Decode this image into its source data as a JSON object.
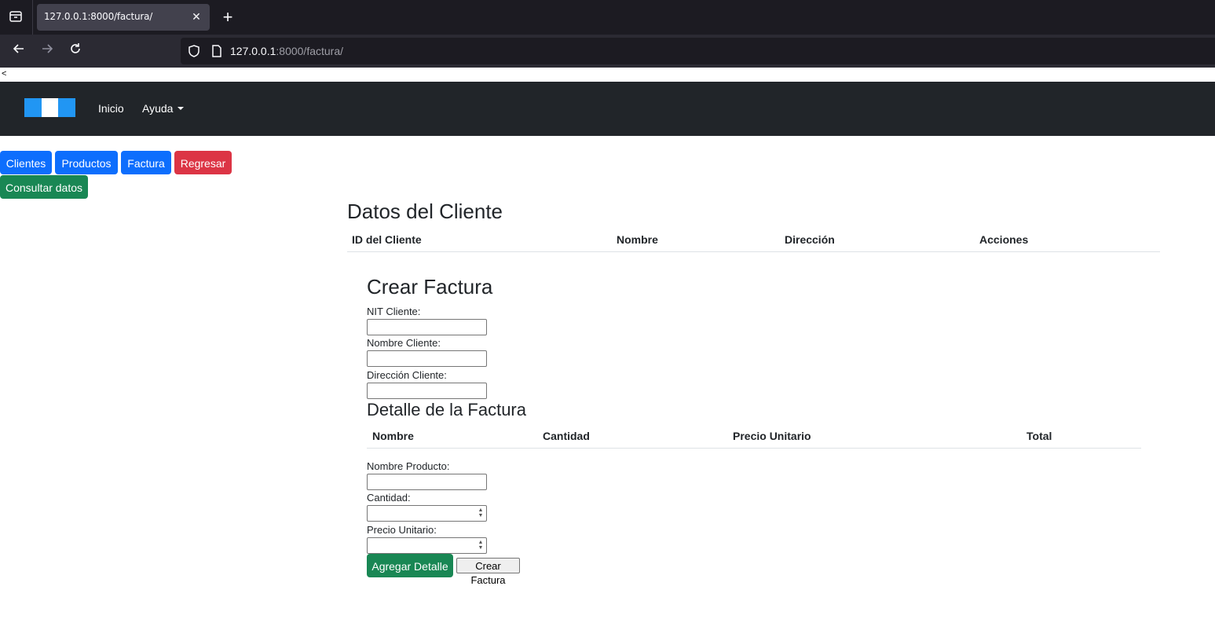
{
  "browser": {
    "tab_title": "127.0.0.1:8000/factura/",
    "url_host": "127.0.0.1",
    "url_path": ":8000/factura/"
  },
  "page": {
    "stray_text": "<",
    "navbar": {
      "brand_colors": [
        "#2196f3",
        "#ffffff",
        "#2196f3"
      ],
      "links": [
        "Inicio",
        "Ayuda"
      ]
    },
    "buttons": {
      "clientes": "Clientes",
      "productos": "Productos",
      "factura": "Factura",
      "regresar": "Regresar",
      "consultar": "Consultar datos"
    },
    "clientes_section": {
      "title": "Datos del Cliente",
      "headers": [
        "ID del Cliente",
        "Nombre",
        "Dirección",
        "Acciones"
      ]
    },
    "factura_form": {
      "title": "Crear Factura",
      "nit_label": "NIT Cliente:",
      "nombre_label": "Nombre Cliente:",
      "direccion_label": "Dirección Cliente:",
      "nit_value": "",
      "nombre_value": "",
      "direccion_value": ""
    },
    "detalle": {
      "title": "Detalle de la Factura",
      "headers": [
        "Nombre",
        "Cantidad",
        "Precio Unitario",
        "Total"
      ],
      "producto_label": "Nombre Producto:",
      "cantidad_label": "Cantidad:",
      "precio_label": "Precio Unitario:",
      "producto_value": "",
      "cantidad_value": "",
      "precio_value": "",
      "agregar_button": "Agregar Detalle",
      "crear_button": "Crear Factura"
    }
  }
}
